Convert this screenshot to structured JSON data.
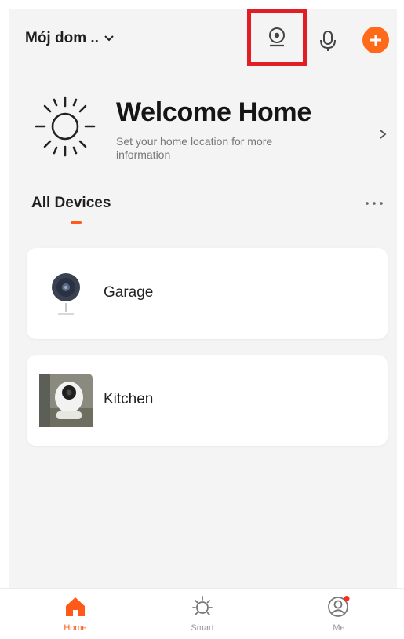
{
  "header": {
    "home_name": "Mój dom ..",
    "icons": {
      "dropdown": "chevron-down-icon",
      "camera": "camera-icon",
      "mic": "microphone-icon",
      "add": "plus-circle-icon"
    },
    "highlight_color": "#e01e24",
    "accent_color": "#ff6a1a"
  },
  "welcome": {
    "title": "Welcome Home",
    "subtitle": "Set your home location for more information",
    "icon": "sun-icon",
    "arrow_icon": "chevron-right-icon"
  },
  "devices_section": {
    "tab_label": "All Devices",
    "more_icon": "more-dots-icon"
  },
  "devices": [
    {
      "name": "Garage",
      "icon": "dome-camera-icon"
    },
    {
      "name": "Kitchen",
      "icon": "indoor-camera-photo-icon"
    }
  ],
  "bottom_nav": {
    "items": [
      {
        "label": "Home",
        "icon": "home-icon",
        "active": true
      },
      {
        "label": "Smart",
        "icon": "smart-sun-icon",
        "active": false
      },
      {
        "label": "Me",
        "icon": "profile-icon",
        "active": false,
        "has_notification": true
      }
    ],
    "active_color": "#ff5a1a",
    "inactive_color": "#9a9a9a"
  }
}
